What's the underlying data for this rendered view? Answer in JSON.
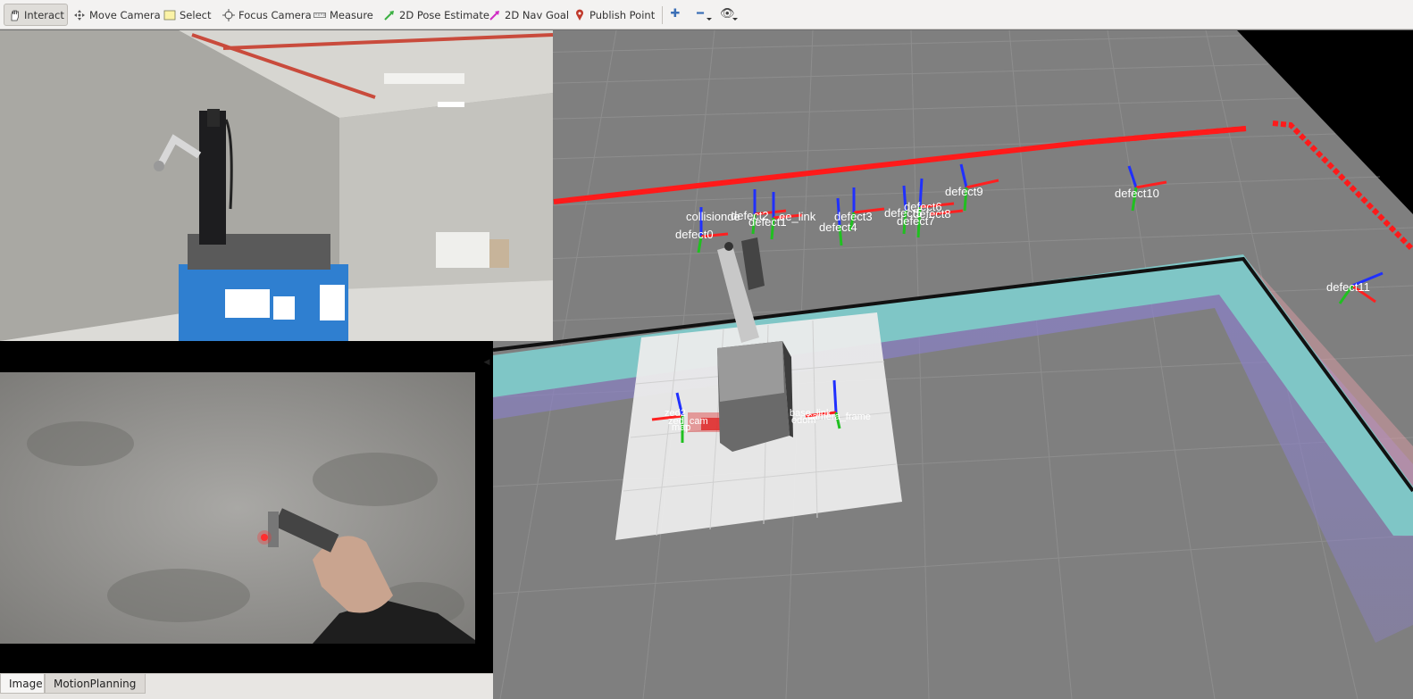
{
  "toolbar": {
    "tools": [
      {
        "label": "Interact",
        "icon": "hand-icon",
        "active": true
      },
      {
        "label": "Move Camera",
        "icon": "move-camera-icon"
      },
      {
        "label": "Select",
        "icon": "select-icon"
      },
      {
        "label": "Focus Camera",
        "icon": "focus-camera-icon"
      },
      {
        "label": "Measure",
        "icon": "ruler-icon"
      },
      {
        "label": "2D Pose Estimate",
        "icon": "green-arrow-icon"
      },
      {
        "label": "2D Nav Goal",
        "icon": "magenta-arrow-icon"
      },
      {
        "label": "Publish Point",
        "icon": "map-pin-icon"
      }
    ],
    "extra_icons": [
      "plus-icon",
      "minus-icon",
      "eye-icon"
    ]
  },
  "view3d": {
    "frame_labels": [
      "collisionde",
      "defect2",
      "ee_link",
      "defect1",
      "defect0",
      "defect3",
      "defect4",
      "defect5",
      "defect6",
      "defect8",
      "defect7",
      "defect9",
      "defect10",
      "defect11",
      "zed2",
      "zed_cam",
      "map",
      "base_link",
      "odom",
      "camera_frame"
    ]
  },
  "tabs": {
    "image": "Image",
    "motion_planning": "MotionPlanning"
  },
  "colors": {
    "grid_floor": "#7f7f7f",
    "laser_red": "#ff1a1a",
    "costmap_cyan": "#7fc6c6",
    "costmap_purple": "#8a80c8",
    "background_black": "#000000"
  }
}
